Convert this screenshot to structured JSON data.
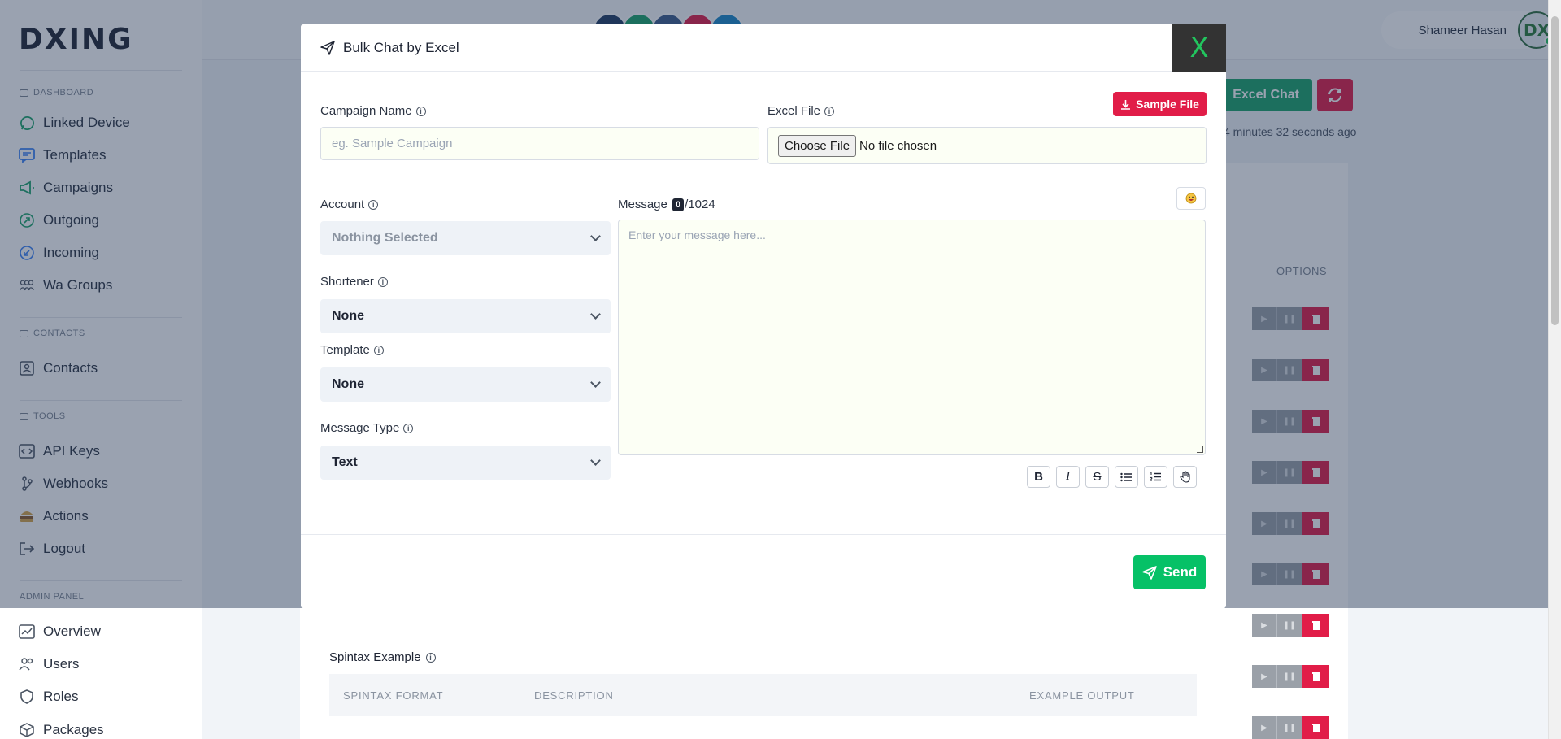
{
  "app": {
    "logo": "DXING"
  },
  "sidebar": {
    "sections": [
      {
        "label": "DASHBOARD",
        "items": [
          {
            "label": "Linked Device",
            "icon": "whatsapp-icon"
          },
          {
            "label": "Templates",
            "icon": "message-icon"
          },
          {
            "label": "Campaigns",
            "icon": "megaphone-icon"
          },
          {
            "label": "Outgoing",
            "icon": "arrow-up-right-icon"
          },
          {
            "label": "Incoming",
            "icon": "arrow-down-left-icon"
          },
          {
            "label": "Wa Groups",
            "icon": "group-icon"
          }
        ]
      },
      {
        "label": "CONTACTS",
        "items": [
          {
            "label": "Contacts",
            "icon": "contact-icon"
          }
        ]
      },
      {
        "label": "TOOLS",
        "items": [
          {
            "label": "API Keys",
            "icon": "code-icon"
          },
          {
            "label": "Webhooks",
            "icon": "webhook-icon"
          },
          {
            "label": "Actions",
            "icon": "burger-icon"
          },
          {
            "label": "Logout",
            "icon": "logout-icon"
          }
        ]
      },
      {
        "label": "ADMIN PANEL",
        "items": [
          {
            "label": "Overview",
            "icon": "overview-icon"
          },
          {
            "label": "Users",
            "icon": "users-icon"
          },
          {
            "label": "Roles",
            "icon": "shield-icon"
          },
          {
            "label": "Packages",
            "icon": "package-icon"
          }
        ]
      }
    ]
  },
  "header": {
    "user_name": "Shameer Hasan",
    "avatar_text": "DX"
  },
  "background": {
    "excel_chat_label": "Excel Chat",
    "updated_text": "4 minutes 32 seconds ago",
    "options_header": "OPTIONS",
    "spintax_title": "Spintax Example",
    "spintax_columns": [
      "SPINTAX FORMAT",
      "DESCRIPTION",
      "EXAMPLE OUTPUT"
    ]
  },
  "modal": {
    "title": "Bulk Chat by Excel",
    "close_label": "X",
    "campaign_name": {
      "label": "Campaign Name",
      "placeholder": "eg. Sample Campaign",
      "value": ""
    },
    "excel_file": {
      "label": "Excel File",
      "button": "Choose File",
      "status": "No file chosen"
    },
    "sample_file_label": "Sample File",
    "account": {
      "label": "Account",
      "value": "Nothing Selected"
    },
    "shortener": {
      "label": "Shortener",
      "value": "None"
    },
    "template": {
      "label": "Template",
      "value": "None"
    },
    "message_type": {
      "label": "Message Type",
      "value": "Text"
    },
    "message": {
      "label": "Message",
      "count": "0",
      "max": "/1024",
      "placeholder": "Enter your message here..."
    },
    "format_buttons": [
      "B",
      "I",
      "S",
      "bullet-list",
      "numbered-list",
      "hand"
    ],
    "send_label": "Send"
  },
  "colors": {
    "primary_green": "#06c167",
    "danger": "#e11d48",
    "excel_green": "#1aa36a"
  }
}
